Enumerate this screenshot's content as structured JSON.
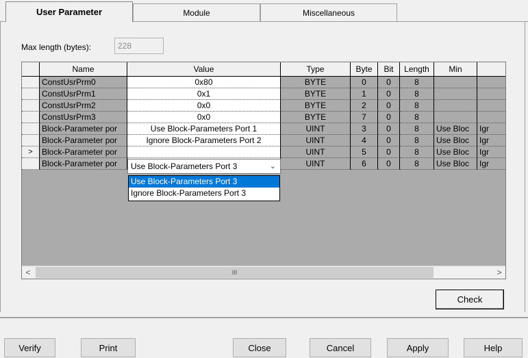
{
  "tabs": [
    "User Parameter",
    "Module",
    "Miscellaneous"
  ],
  "max_length": {
    "label": "Max length (bytes):",
    "value": "228"
  },
  "table": {
    "columns": [
      "Name",
      "Value",
      "Type",
      "Byte",
      "Bit",
      "Length",
      "Min",
      ""
    ],
    "rows": [
      {
        "name": "ConstUsrPrm0",
        "value": "0x80",
        "type": "BYTE",
        "byte": "0",
        "bit": "0",
        "length": "8",
        "min": "",
        "max": ""
      },
      {
        "name": "ConstUsrPrm1",
        "value": "0x1",
        "type": "BYTE",
        "byte": "1",
        "bit": "0",
        "length": "8",
        "min": "",
        "max": ""
      },
      {
        "name": "ConstUsrPrm2",
        "value": "0x0",
        "type": "BYTE",
        "byte": "2",
        "bit": "0",
        "length": "8",
        "min": "",
        "max": ""
      },
      {
        "name": "ConstUsrPrm3",
        "value": "0x0",
        "type": "BYTE",
        "byte": "7",
        "bit": "0",
        "length": "8",
        "min": "",
        "max": ""
      },
      {
        "name": "Block-Parameter por",
        "value": "Use Block-Parameters Port 1",
        "type": "UINT",
        "byte": "3",
        "bit": "0",
        "length": "8",
        "min": "Use Bloc",
        "max": "Igr"
      },
      {
        "name": "Block-Parameter por",
        "value": "Ignore Block-Parameters Port 2",
        "type": "UINT",
        "byte": "4",
        "bit": "0",
        "length": "8",
        "min": "Use Bloc",
        "max": "Igr"
      },
      {
        "name": "Block-Parameter por",
        "value": "",
        "type": "UINT",
        "byte": "5",
        "bit": "0",
        "length": "8",
        "min": "Use Bloc",
        "max": "Igr"
      },
      {
        "name": "Block-Parameter por",
        "value": "",
        "type": "UINT",
        "byte": "6",
        "bit": "0",
        "length": "8",
        "min": "Use Bloc",
        "max": "Igr"
      }
    ],
    "current_row_marker": ">"
  },
  "dropdown": {
    "selected": "Use Block-Parameters Port 3",
    "options": [
      "Use Block-Parameters Port 3",
      "Ignore Block-Parameters Port 3"
    ]
  },
  "scroll": {
    "left": "<",
    "right": ">",
    "grip": "III"
  },
  "buttons": {
    "check": "Check",
    "verify": "Verify",
    "print": "Print",
    "close": "Close",
    "cancel": "Cancel",
    "apply": "Apply",
    "help": "Help"
  }
}
